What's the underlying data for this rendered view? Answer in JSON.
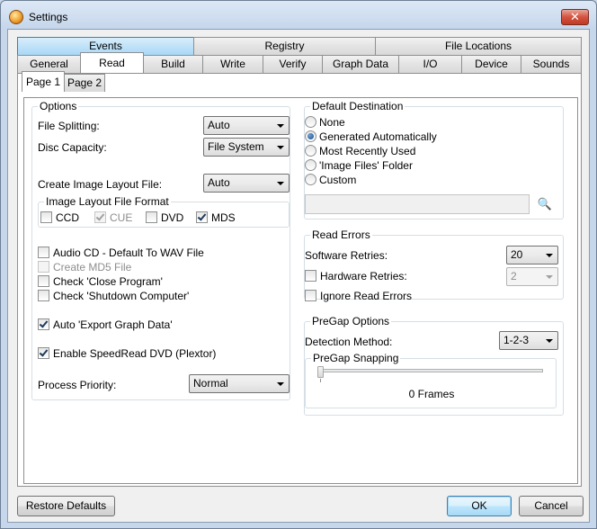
{
  "window": {
    "title": "Settings",
    "close_glyph": "✕"
  },
  "tabs_row1": [
    "Events",
    "Registry",
    "File Locations"
  ],
  "tabs_row2": [
    "General",
    "Read",
    "Build",
    "Write",
    "Verify",
    "Graph Data",
    "I/O",
    "Device",
    "Sounds"
  ],
  "subtabs": [
    "Page 1",
    "Page 2"
  ],
  "options": {
    "group_label": "Options",
    "file_splitting_label": "File Splitting:",
    "file_splitting_value": "Auto",
    "disc_capacity_label": "Disc Capacity:",
    "disc_capacity_value": "File System",
    "create_layout_label": "Create Image Layout File:",
    "create_layout_value": "Auto",
    "layout_format_label": "Image Layout File Format",
    "fmt_ccd": "CCD",
    "fmt_cue": "CUE",
    "fmt_dvd": "DVD",
    "fmt_mds": "MDS",
    "audio_cd": "Audio CD - Default To WAV File",
    "create_md5": "Create MD5 File",
    "check_close": "Check 'Close Program'",
    "check_shutdown": "Check 'Shutdown Computer'",
    "auto_export": "Auto 'Export Graph Data'",
    "speedread": "Enable SpeedRead DVD (Plextor)",
    "priority_label": "Process Priority:",
    "priority_value": "Normal"
  },
  "destination": {
    "group_label": "Default Destination",
    "none": "None",
    "generated": "Generated Automatically",
    "most_recent": "Most Recently Used",
    "image_files": "'Image Files' Folder",
    "custom": "Custom",
    "browse_icon": "🔍"
  },
  "read_errors": {
    "group_label": "Read Errors",
    "software_label": "Software Retries:",
    "software_value": "20",
    "hardware_label": "Hardware Retries:",
    "hardware_value": "2",
    "ignore_label": "Ignore Read Errors"
  },
  "pregap": {
    "group_label": "PreGap Options",
    "detection_label": "Detection Method:",
    "detection_value": "1-2-3",
    "snapping_label": "PreGap Snapping",
    "frames_label": "0 Frames",
    "slider_position": 0
  },
  "buttons": {
    "restore": "Restore Defaults",
    "ok": "OK",
    "cancel": "Cancel"
  },
  "colors": {
    "title_bg": "#c6d7ec",
    "close_red": "#c13a25",
    "tab_highlight": "#bfe2f8",
    "default_button": "#3c7fb1"
  }
}
